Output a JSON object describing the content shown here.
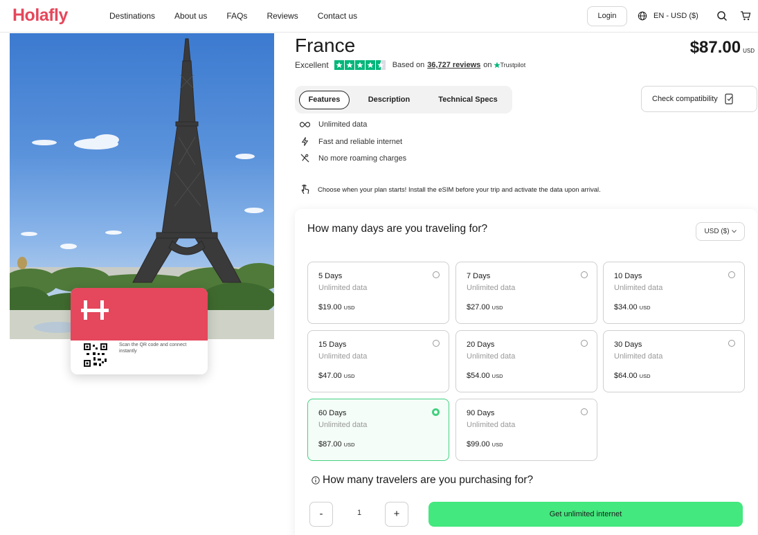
{
  "header": {
    "logo": "Holafly",
    "nav": [
      "Destinations",
      "About us",
      "FAQs",
      "Reviews",
      "Contact us"
    ],
    "login_label": "Login",
    "language": "EN - USD ($)"
  },
  "hero": {
    "card_caption": "Scan the QR code and connect instantly"
  },
  "product": {
    "title": "France",
    "price": "$87.00",
    "price_currency": "USD",
    "rating": {
      "label": "Excellent",
      "stars": 4.5,
      "based_on": "Based on",
      "count": "36,727 reviews",
      "on": "on",
      "provider": "Trustpilot"
    },
    "tabs": [
      "Features",
      "Description",
      "Technical Specs"
    ],
    "active_tab": "Features",
    "compat_label": "Check compatibility",
    "features": [
      {
        "icon": "infinity-icon",
        "text": "Unlimited data"
      },
      {
        "icon": "lightning-icon",
        "text": "Fast and reliable internet"
      },
      {
        "icon": "no-roaming-icon",
        "text": "No more roaming charges"
      }
    ],
    "notice": "Choose when your plan starts! Install the eSIM before your trip and activate the data upon arrival."
  },
  "plans_section": {
    "question": "How many days are you traveling for?",
    "currency_select": "USD ($)",
    "plans": [
      {
        "days": "5 Days",
        "sub": "Unlimited data",
        "price": "$19.00",
        "currency": "USD",
        "selected": false
      },
      {
        "days": "7 Days",
        "sub": "Unlimited data",
        "price": "$27.00",
        "currency": "USD",
        "selected": false
      },
      {
        "days": "10 Days",
        "sub": "Unlimited data",
        "price": "$34.00",
        "currency": "USD",
        "selected": false
      },
      {
        "days": "15 Days",
        "sub": "Unlimited data",
        "price": "$47.00",
        "currency": "USD",
        "selected": false
      },
      {
        "days": "20 Days",
        "sub": "Unlimited data",
        "price": "$54.00",
        "currency": "USD",
        "selected": false
      },
      {
        "days": "30 Days",
        "sub": "Unlimited data",
        "price": "$64.00",
        "currency": "USD",
        "selected": false
      },
      {
        "days": "60 Days",
        "sub": "Unlimited data",
        "price": "$87.00",
        "currency": "USD",
        "selected": true
      },
      {
        "days": "90 Days",
        "sub": "Unlimited data",
        "price": "$99.00",
        "currency": "USD",
        "selected": false
      }
    ],
    "travelers_question": "How many travelers are you purchasing for?",
    "minus_label": "-",
    "quantity": "1",
    "plus_label": "+",
    "buy_label": "Get unlimited internet"
  },
  "colors": {
    "brand": "#e5475c",
    "accent_green": "#43e87e",
    "trustpilot_green": "#00b67a"
  }
}
